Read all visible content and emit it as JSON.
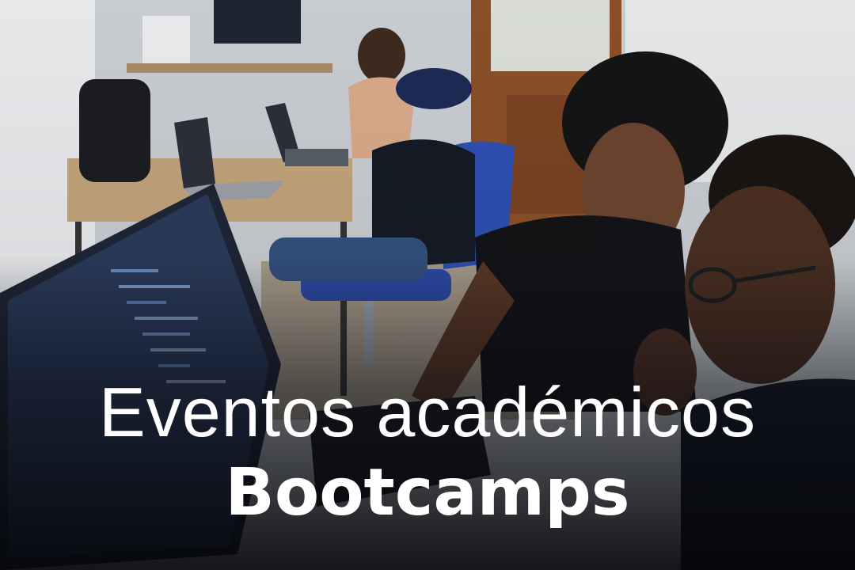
{
  "headline": {
    "line1": "Eventos académicos",
    "line2": "Bootcamps"
  },
  "colors": {
    "text": "#ffffff",
    "overlay": "#0a0e16"
  }
}
